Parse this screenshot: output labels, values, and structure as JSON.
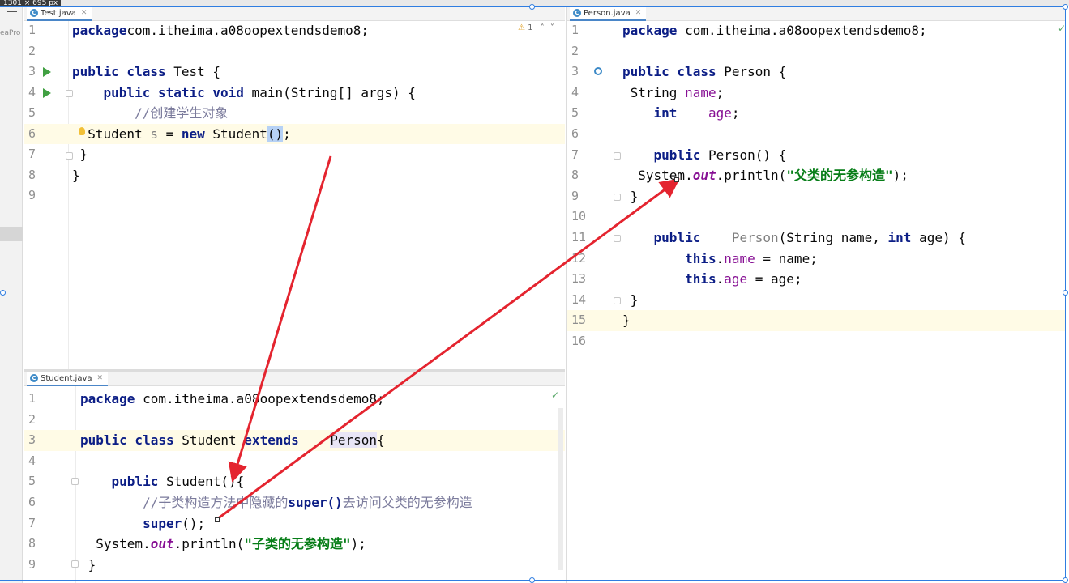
{
  "screen": {
    "dimension_badge": "1301 × 695 px",
    "project_label": "eaPro"
  },
  "panes": {
    "test": {
      "tab_label": "Test.java",
      "warning_count": "1",
      "lines": [
        {
          "n": "1",
          "parts": [
            [
              "kw",
              "package"
            ],
            [
              "",
              "com.itheima.a08oopextendsdemo8;"
            ]
          ]
        },
        {
          "n": "2",
          "parts": []
        },
        {
          "n": "3",
          "parts": [
            [
              "kw",
              "public class"
            ],
            [
              "",
              " Test {"
            ]
          ]
        },
        {
          "n": "4",
          "parts": [
            [
              "",
              " "
            ],
            [
              "kw",
              "public static void"
            ],
            [
              "",
              " main(String[] args) {"
            ]
          ]
        },
        {
          "n": "5",
          "parts": [
            [
              "",
              "  "
            ],
            [
              "cm2",
              "//创建学生对象"
            ]
          ]
        },
        {
          "n": "6",
          "parts": [
            [
              "",
              "  Student "
            ],
            [
              "gray",
              "s"
            ],
            [
              "",
              " = "
            ],
            [
              "kw",
              "new"
            ],
            [
              "",
              " Student"
            ],
            [
              "parenhl",
              "()"
            ],
            [
              "",
              ";"
            ]
          ]
        },
        {
          "n": "7",
          "parts": [
            [
              "",
              " }"
            ]
          ]
        },
        {
          "n": "8",
          "parts": [
            [
              "",
              "}"
            ]
          ]
        },
        {
          "n": "9",
          "parts": []
        }
      ]
    },
    "student": {
      "tab_label": "Student.java",
      "lines": [
        {
          "n": "1",
          "parts": [
            [
              "kw",
              "package"
            ],
            [
              "",
              " com.itheima.a08oopextendsdemo8;"
            ]
          ]
        },
        {
          "n": "2",
          "parts": []
        },
        {
          "n": "3",
          "parts": [
            [
              "kw",
              "public class"
            ],
            [
              "",
              " Student "
            ],
            [
              "kw",
              "extends"
            ],
            [
              "",
              " "
            ],
            [
              "superhl",
              "Person"
            ],
            [
              "",
              "{"
            ]
          ]
        },
        {
          "n": "4",
          "parts": []
        },
        {
          "n": "5",
          "parts": [
            [
              "",
              " "
            ],
            [
              "kw",
              "public"
            ],
            [
              "",
              " Student(){"
            ]
          ]
        },
        {
          "n": "6",
          "parts": [
            [
              "",
              "  "
            ],
            [
              "cm2",
              "//子类构造方法中隐藏的"
            ],
            [
              "kw",
              "super()"
            ],
            [
              "cm2",
              "去访问父类的无参构造"
            ]
          ]
        },
        {
          "n": "7",
          "parts": [
            [
              "",
              "  "
            ],
            [
              "kw",
              "super"
            ],
            [
              "",
              "();"
            ]
          ]
        },
        {
          "n": "8",
          "parts": [
            [
              "",
              "  System."
            ],
            [
              "ital",
              "out"
            ],
            [
              "",
              ".println("
            ],
            [
              "str",
              "\"子类的无参构造\""
            ],
            [
              "",
              ");"
            ]
          ]
        },
        {
          "n": "9",
          "parts": [
            [
              "",
              " }"
            ]
          ]
        }
      ]
    },
    "person": {
      "tab_label": "Person.java",
      "lines": [
        {
          "n": "1",
          "parts": [
            [
              "kw",
              "package"
            ],
            [
              "",
              " com.itheima.a08oopextendsdemo8;"
            ]
          ]
        },
        {
          "n": "2",
          "parts": []
        },
        {
          "n": "3",
          "parts": [
            [
              "kw",
              "public class"
            ],
            [
              "",
              " Person {"
            ]
          ]
        },
        {
          "n": "4",
          "parts": [
            [
              "",
              " String "
            ],
            [
              "fld",
              "name"
            ],
            [
              "",
              ";"
            ]
          ]
        },
        {
          "n": "5",
          "parts": [
            [
              "",
              " "
            ],
            [
              "kw",
              "int"
            ],
            [
              "",
              " "
            ],
            [
              "fld",
              "age"
            ],
            [
              "",
              ";"
            ]
          ]
        },
        {
          "n": "6",
          "parts": []
        },
        {
          "n": "7",
          "parts": [
            [
              "",
              " "
            ],
            [
              "kw",
              "public"
            ],
            [
              "",
              " Person() {"
            ]
          ]
        },
        {
          "n": "8",
          "parts": [
            [
              "",
              "  System."
            ],
            [
              "ital",
              "out"
            ],
            [
              "",
              ".println("
            ],
            [
              "str",
              "\"父类的无参构造\""
            ],
            [
              "",
              ");"
            ]
          ]
        },
        {
          "n": "9",
          "parts": [
            [
              "",
              " }"
            ]
          ]
        },
        {
          "n": "10",
          "parts": []
        },
        {
          "n": "11",
          "parts": [
            [
              "",
              " "
            ],
            [
              "kw",
              "public"
            ],
            [
              "",
              " "
            ],
            [
              "gray",
              "Person"
            ],
            [
              "",
              "(String name, "
            ],
            [
              "kw",
              "int"
            ],
            [
              "",
              " age) {"
            ]
          ]
        },
        {
          "n": "12",
          "parts": [
            [
              "",
              "  "
            ],
            [
              "kw",
              "this"
            ],
            [
              "",
              "."
            ],
            [
              "fld",
              "name"
            ],
            [
              "",
              " = name;"
            ]
          ]
        },
        {
          "n": "13",
          "parts": [
            [
              "",
              "  "
            ],
            [
              "kw",
              "this"
            ],
            [
              "",
              "."
            ],
            [
              "fld",
              "age"
            ],
            [
              "",
              " = age;"
            ]
          ]
        },
        {
          "n": "14",
          "parts": [
            [
              "",
              " }"
            ]
          ]
        },
        {
          "n": "15",
          "parts": [
            [
              "",
              "}"
            ]
          ]
        },
        {
          "n": "16",
          "parts": []
        }
      ]
    }
  },
  "colors": {
    "annotation_arrow": "#e4242f",
    "keyword": "#0c1e86",
    "string": "#067d17",
    "field": "#871094"
  }
}
